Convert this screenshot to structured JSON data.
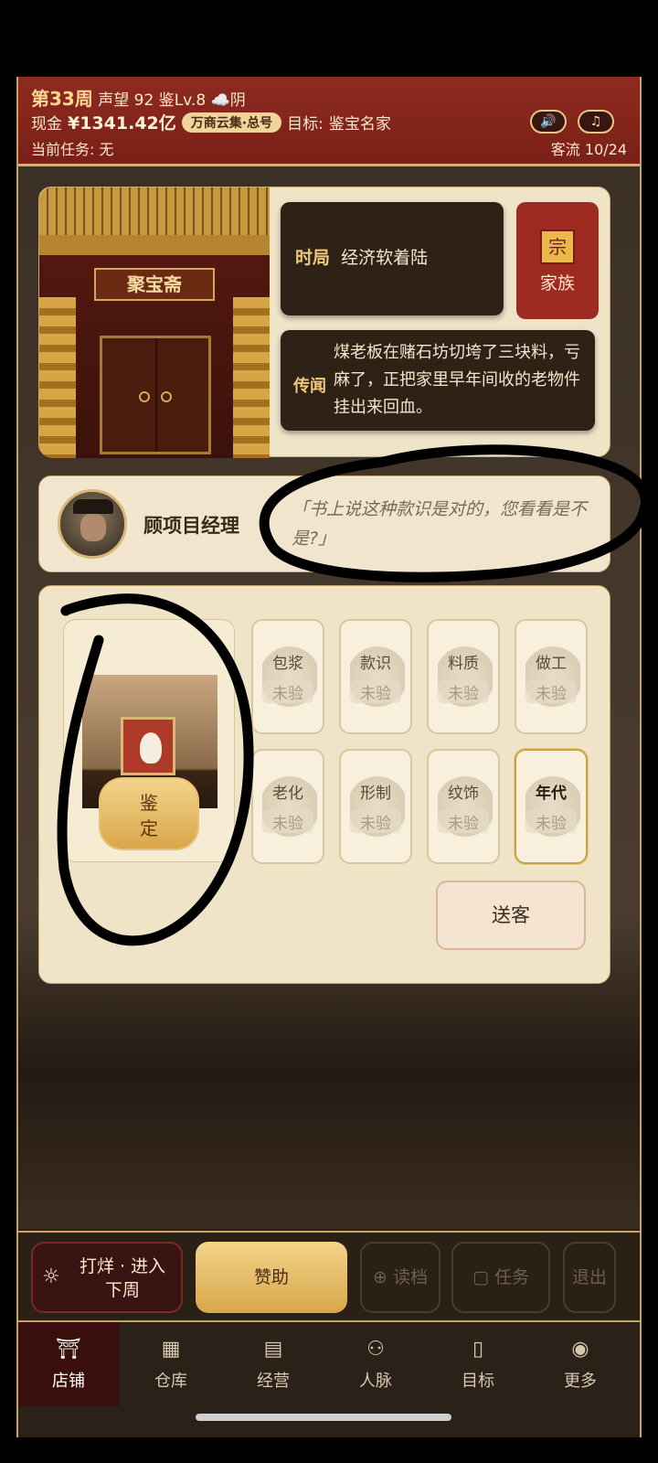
{
  "header": {
    "week": "第33周",
    "reputation_label": "声望",
    "reputation_value": "92",
    "level": "鉴Lv.8",
    "weather": "☁️阴",
    "cash_label": "现金",
    "cash_value": "¥1341.42亿",
    "badge": "万商云集·总号",
    "goal_label": "目标:",
    "goal_value": "鉴宝名家",
    "task_label": "当前任务:",
    "task_value": "无",
    "customer_flow": "客流 10/24",
    "sound_icon": "🔊",
    "music_icon": "♫"
  },
  "shop": {
    "sign": "聚宝斋"
  },
  "info": {
    "situation_label": "时局",
    "situation_text": "经济软着陆",
    "rumor_label": "传闻",
    "rumor_text": "煤老板在赌石坊切垮了三块料，亏麻了，正把家里早年间收的老物件挂出来回血。",
    "family_label": "家族",
    "family_icon": "宗"
  },
  "customer": {
    "name": "顾项目经理",
    "quote": "「书上说这种款识是对的，您看看是不是?」"
  },
  "appraisal": {
    "button": "鉴\n定",
    "button_top": "鉴",
    "button_bottom": "定",
    "tiles": [
      {
        "name": "包浆",
        "status": "未验"
      },
      {
        "name": "款识",
        "status": "未验"
      },
      {
        "name": "料质",
        "status": "未验"
      },
      {
        "name": "做工",
        "status": "未验"
      },
      {
        "name": "老化",
        "status": "未验"
      },
      {
        "name": "形制",
        "status": "未验"
      },
      {
        "name": "纹饰",
        "status": "未验"
      },
      {
        "name": "年代",
        "status": "未验"
      }
    ],
    "send_off": "送客"
  },
  "actions": {
    "enter_line1": "打烊 · 进入",
    "enter_line2": "下周",
    "help": "赞助",
    "load": "读档",
    "tasks": "任务",
    "exit": "退出"
  },
  "nav": [
    {
      "label": "店铺",
      "icon": "shop-icon",
      "active": true
    },
    {
      "label": "仓库",
      "icon": "warehouse-icon",
      "active": false
    },
    {
      "label": "经营",
      "icon": "abacus-icon",
      "active": false
    },
    {
      "label": "人脉",
      "icon": "people-icon",
      "active": false
    },
    {
      "label": "目标",
      "icon": "scroll-icon",
      "active": false
    },
    {
      "label": "更多",
      "icon": "more-icon",
      "active": false
    }
  ],
  "colors": {
    "header_red": "#8e2a20",
    "gold": "#d9a64a",
    "panel": "#efe3c8"
  }
}
